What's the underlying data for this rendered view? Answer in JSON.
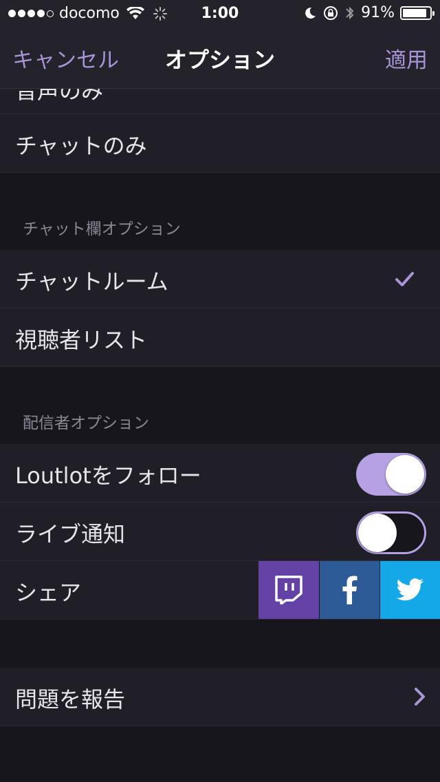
{
  "status_bar": {
    "carrier": "docomo",
    "time": "1:00",
    "battery_percent": "91%",
    "battery_level": 0.91,
    "signal_bars_filled": 4,
    "signal_bars_total": 5
  },
  "nav": {
    "cancel_label": "キャンセル",
    "title": "オプション",
    "apply_label": "適用"
  },
  "rows": {
    "partial_label": "音声のみ",
    "chat_only": "チャットのみ"
  },
  "chat_section": {
    "header": "チャット欄オプション",
    "chat_room": "チャットルーム",
    "chat_room_selected": true,
    "viewer_list": "視聴者リスト"
  },
  "streamer_section": {
    "header": "配信者オプション",
    "follow_label": "Loutlotをフォロー",
    "follow_on": true,
    "live_notify_label": "ライブ通知",
    "live_notify_on": false,
    "share_label": "シェア",
    "share_buttons": [
      "twitch-icon",
      "facebook-icon",
      "twitter-icon"
    ]
  },
  "report": {
    "label": "問題を報告"
  },
  "colors": {
    "accent": "#a894d6",
    "twitch": "#6441a5",
    "facebook": "#2c5b98",
    "twitter": "#14a8e8"
  }
}
